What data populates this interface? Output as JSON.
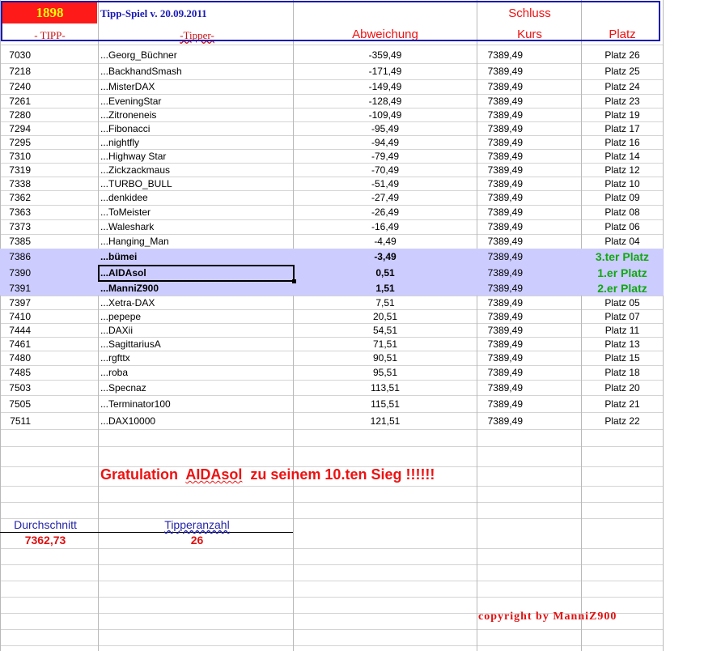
{
  "header": {
    "year": "1898",
    "title": "Tipp-Spiel v. 20.09.2011",
    "schluss": "Schluss",
    "col_tipp": "- TIPP-",
    "col_tipper": "-Tipper-",
    "col_abweichung": "Abweichung",
    "col_kurs": "Kurs",
    "col_platz": "Platz"
  },
  "rows": [
    {
      "tipp": "7030",
      "name": "...Georg_Büchner",
      "abw": "-359,49",
      "kurs": "7389,49",
      "platz": "Platz 26"
    },
    {
      "tipp": "7218",
      "name": "...BackhandSmash",
      "abw": "-171,49",
      "kurs": "7389,49",
      "platz": "Platz 25"
    },
    {
      "tipp": "7240",
      "name": "...MisterDAX",
      "abw": "-149,49",
      "kurs": "7389,49",
      "platz": "Platz 24"
    },
    {
      "tipp": "7261",
      "name": "...EveningStar",
      "abw": "-128,49",
      "kurs": "7389,49",
      "platz": "Platz 23"
    },
    {
      "tipp": "7280",
      "name": "...Zitroneneis",
      "abw": "-109,49",
      "kurs": "7389,49",
      "platz": "Platz 19"
    },
    {
      "tipp": "7294",
      "name": "...Fibonacci",
      "abw": "-95,49",
      "kurs": "7389,49",
      "platz": "Platz 17"
    },
    {
      "tipp": "7295",
      "name": "...nightfly",
      "abw": "-94,49",
      "kurs": "7389,49",
      "platz": "Platz 16"
    },
    {
      "tipp": "7310",
      "name": "...Highway Star",
      "abw": "-79,49",
      "kurs": "7389,49",
      "platz": "Platz 14"
    },
    {
      "tipp": "7319",
      "name": "...Zickzackmaus",
      "abw": "-70,49",
      "kurs": "7389,49",
      "platz": "Platz 12"
    },
    {
      "tipp": "7338",
      "name": "...TURBO_BULL",
      "abw": "-51,49",
      "kurs": "7389,49",
      "platz": "Platz 10"
    },
    {
      "tipp": "7362",
      "name": "...denkidee",
      "abw": "-27,49",
      "kurs": "7389,49",
      "platz": "Platz 09"
    },
    {
      "tipp": "7363",
      "name": "...ToMeister",
      "abw": "-26,49",
      "kurs": "7389,49",
      "platz": "Platz 08"
    },
    {
      "tipp": "7373",
      "name": "...Waleshark",
      "abw": "-16,49",
      "kurs": "7389,49",
      "platz": "Platz 06"
    },
    {
      "tipp": "7385",
      "name": "...Hanging_Man",
      "abw": "-4,49",
      "kurs": "7389,49",
      "platz": "Platz 04"
    },
    {
      "tipp": "7386",
      "name": "...bümei",
      "abw": "-3,49",
      "kurs": "7389,49",
      "platz": "3.ter Platz"
    },
    {
      "tipp": "7390",
      "name": "...AIDAsol",
      "abw": "0,51",
      "kurs": "7389,49",
      "platz": "1.er Platz"
    },
    {
      "tipp": "7391",
      "name": "...ManniZ900",
      "abw": "1,51",
      "kurs": "7389,49",
      "platz": "2.er Platz"
    },
    {
      "tipp": "7397",
      "name": "...Xetra-DAX",
      "abw": "7,51",
      "kurs": "7389,49",
      "platz": "Platz 05"
    },
    {
      "tipp": "7410",
      "name": "...pepepe",
      "abw": "20,51",
      "kurs": "7389,49",
      "platz": "Platz 07"
    },
    {
      "tipp": "7444",
      "name": "...DAXii",
      "abw": "54,51",
      "kurs": "7389,49",
      "platz": "Platz 11"
    },
    {
      "tipp": "7461",
      "name": "...SagittariusA",
      "abw": "71,51",
      "kurs": "7389,49",
      "platz": "Platz 13"
    },
    {
      "tipp": "7480",
      "name": "...rgfttx",
      "abw": "90,51",
      "kurs": "7389,49",
      "platz": "Platz 15"
    },
    {
      "tipp": "7485",
      "name": "...roba",
      "abw": "95,51",
      "kurs": "7389,49",
      "platz": "Platz 18"
    },
    {
      "tipp": "7503",
      "name": "...Specnaz",
      "abw": "113,51",
      "kurs": "7389,49",
      "platz": "Platz 20"
    },
    {
      "tipp": "7505",
      "name": "...Terminator100",
      "abw": "115,51",
      "kurs": "7389,49",
      "platz": "Platz 21"
    },
    {
      "tipp": "7511",
      "name": "...DAX10000",
      "abw": "121,51",
      "kurs": "7389,49",
      "platz": "Platz 22"
    }
  ],
  "highlighted_rows": [
    "7386",
    "7390",
    "7391"
  ],
  "selected_cell": "...AIDAsol",
  "congrats": {
    "prefix": "Gratulation",
    "winner": "AIDAsol",
    "suffix": "zu seinem 10.ten Sieg !!!!!!"
  },
  "stats": {
    "avg_label": "Durchschnitt",
    "avg_value": "7362,73",
    "count_label": "Tipperanzahl",
    "count_value": "26"
  },
  "footer": {
    "copyright": "copyright by ManniZ900"
  },
  "colors": {
    "year_bg": "#ff1a1a",
    "year_fg": "#ffff00",
    "header_border": "#1a1ab4",
    "highlight_row": "#ccccff",
    "top_place": "#11a811",
    "accent_red": "#ee1111"
  }
}
